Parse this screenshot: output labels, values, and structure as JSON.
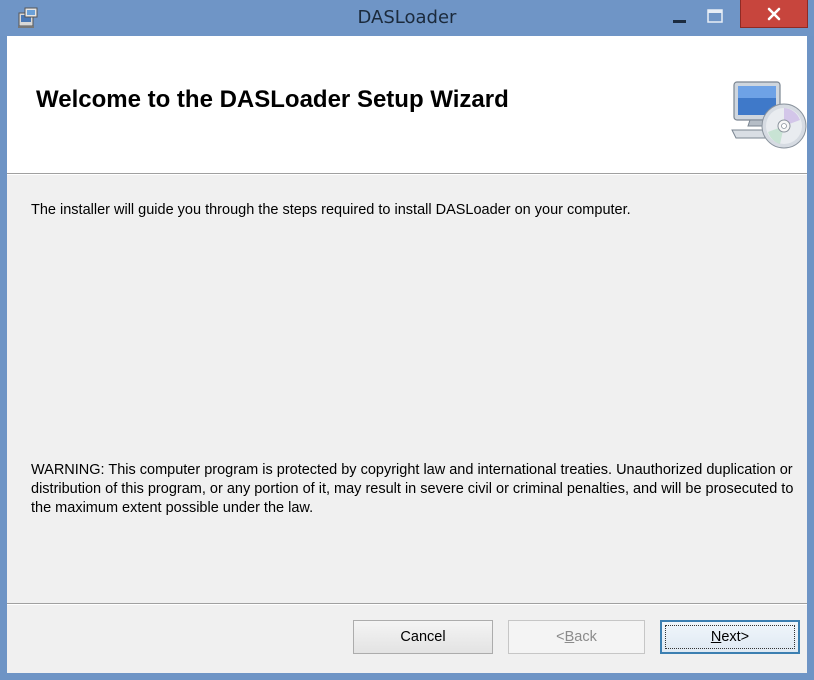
{
  "window": {
    "title": "DASLoader",
    "controls": {
      "minimize_glyph": "—",
      "maximize_glyph": "☐",
      "close_glyph": "✕"
    }
  },
  "header": {
    "title": "Welcome to the DASLoader Setup Wizard",
    "icon": "computer-cd-icon"
  },
  "body": {
    "intro": "The installer will guide you through the steps required to install DASLoader on your computer.",
    "warning": "WARNING: This computer program is protected by copyright law and international treaties. Unauthorized duplication or distribution of this program, or any portion of it, may result in severe civil or criminal penalties, and will be prosecuted to the maximum extent possible under the law."
  },
  "buttons": {
    "cancel": "Cancel",
    "back": {
      "prefix": "< ",
      "mnemonic": "B",
      "rest": "ack"
    },
    "next": {
      "mnemonic": "N",
      "rest": "ext",
      "suffix": " >"
    }
  },
  "colors": {
    "titlebar": "#6f95c6",
    "close_button": "#c7453d",
    "dialog_bg": "#f0f0f0",
    "focus_border": "#3c7fb1"
  }
}
